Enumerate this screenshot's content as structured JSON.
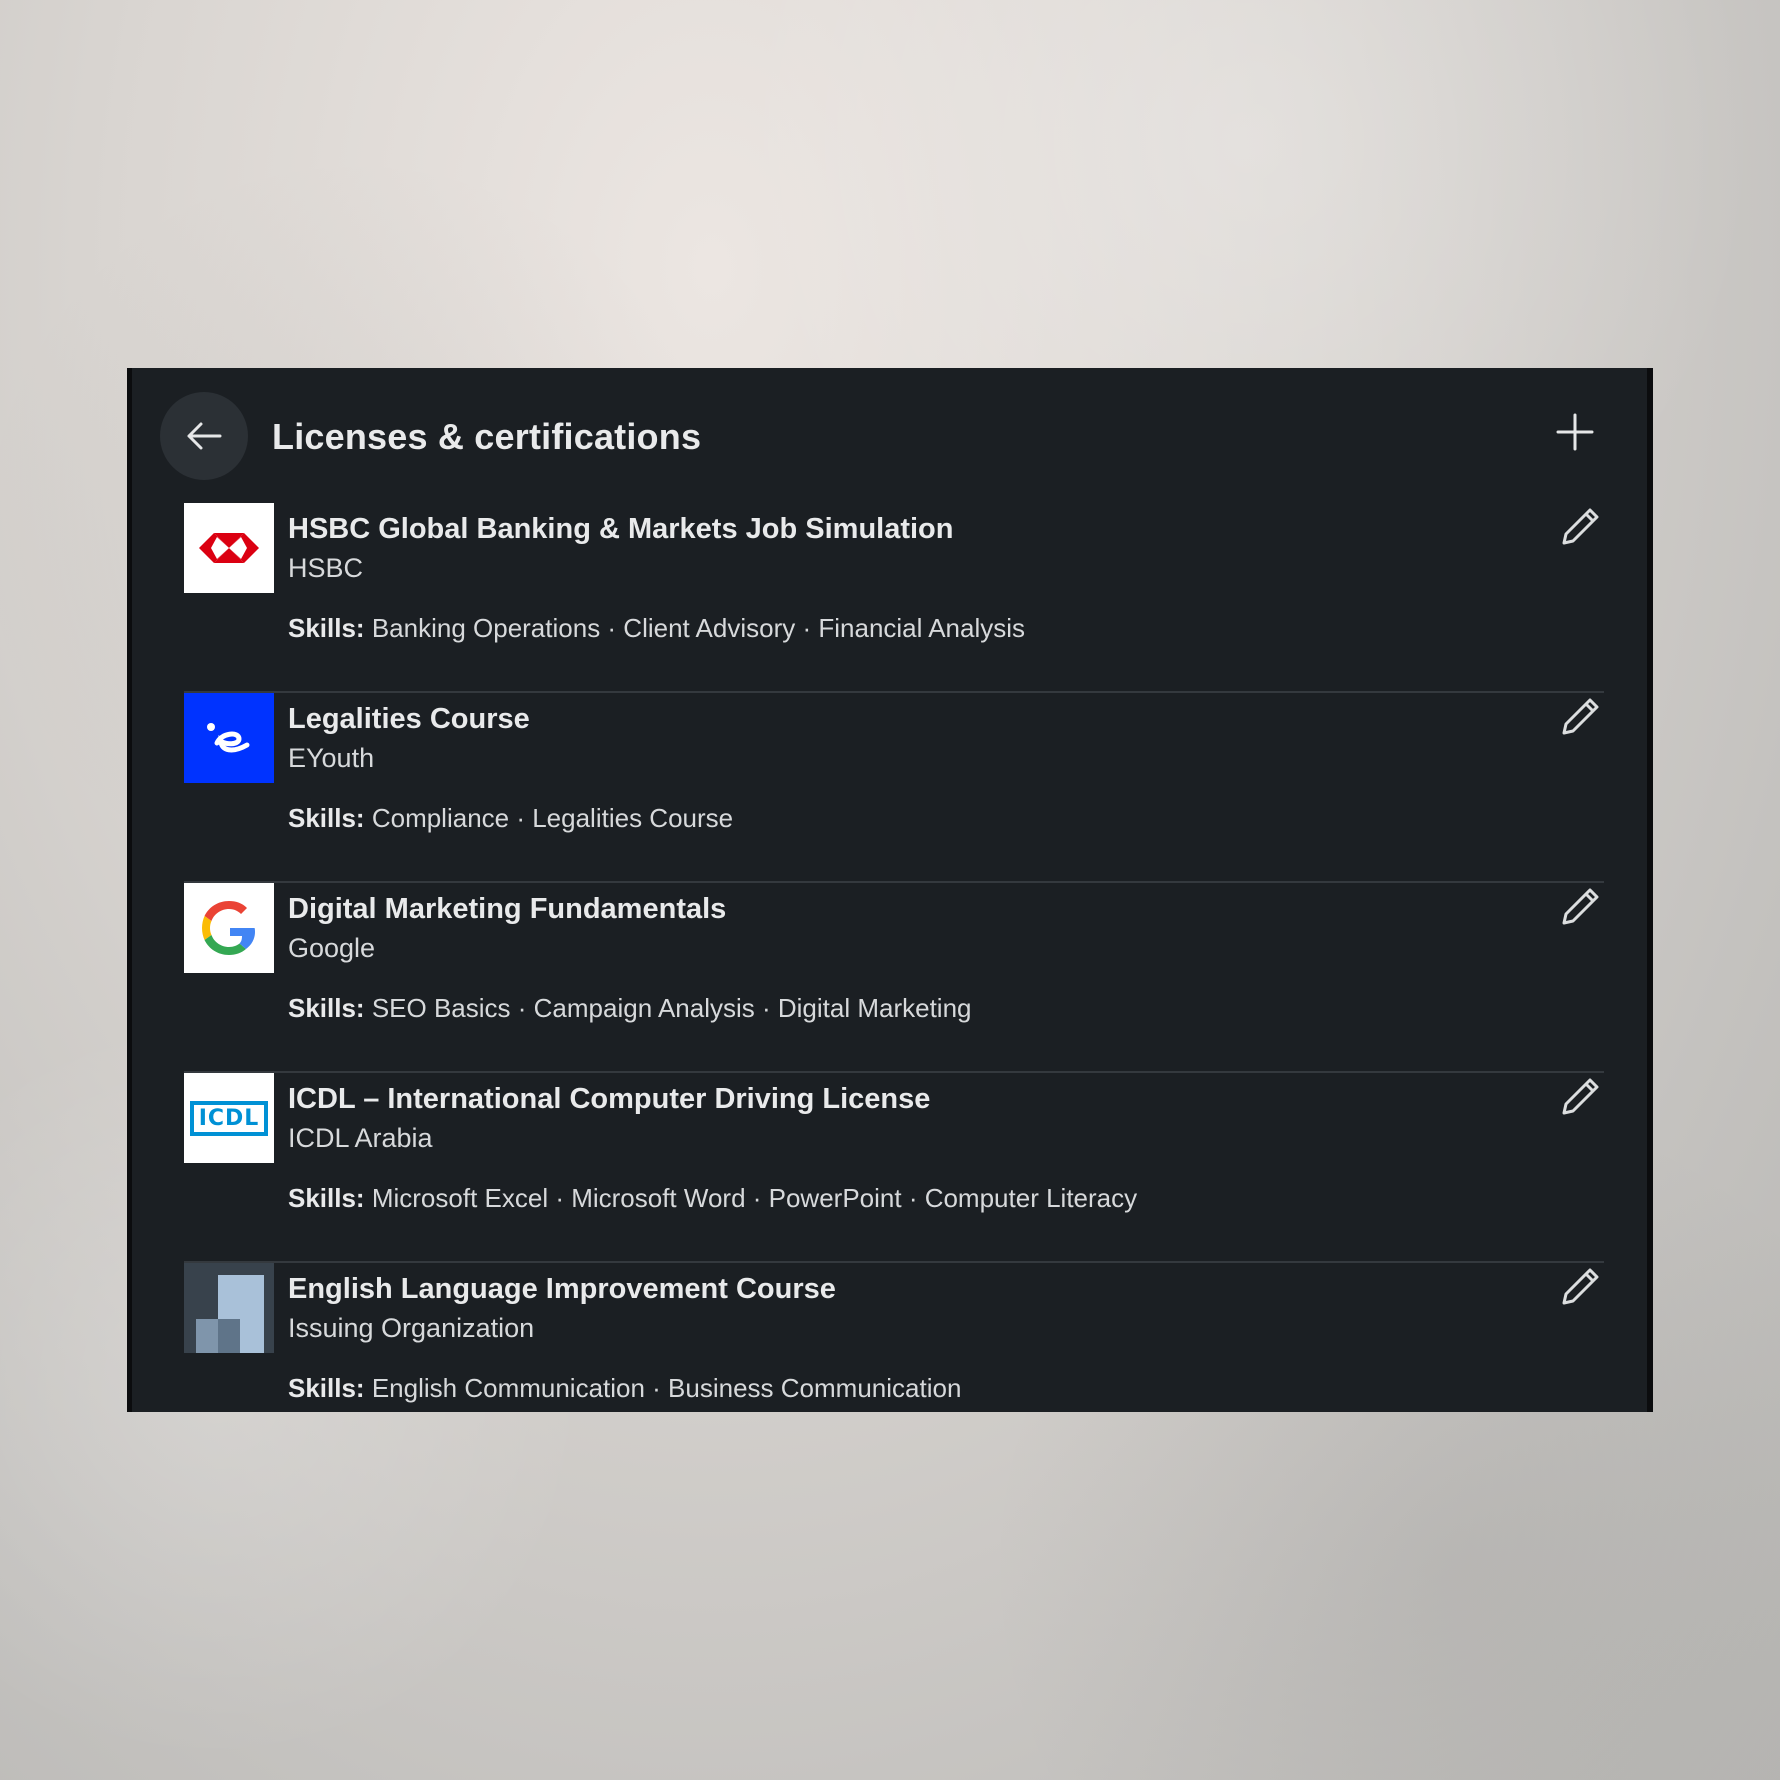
{
  "header": {
    "title": "Licenses & certifications"
  },
  "skills_label": "Skills:",
  "colors": {
    "panel_bg": "#1b1f23",
    "divider": "#34393e",
    "hsbc_red": "#db0011",
    "eyouth_blue": "#0033ff",
    "icdl_blue": "#0091d5"
  },
  "items": [
    {
      "title": "HSBC Global Banking & Markets Job Simulation",
      "issuer": "HSBC",
      "skills": "Banking Operations · Client Advisory · Financial Analysis",
      "logo": "hsbc-logo"
    },
    {
      "title": "Legalities Course",
      "issuer": "EYouth",
      "skills": "Compliance · Legalities Course",
      "logo": "eyouth-logo"
    },
    {
      "title": "Digital Marketing Fundamentals",
      "issuer": "Google",
      "skills": "SEO Basics · Campaign Analysis · Digital Marketing",
      "logo": "google-logo"
    },
    {
      "title": "ICDL – International Computer Driving License",
      "issuer": "ICDL Arabia",
      "skills": "Microsoft Excel · Microsoft Word · PowerPoint · Computer Literacy",
      "logo": "icdl-logo",
      "logo_text": "ICDL"
    },
    {
      "title": "English Language Improvement Course",
      "issuer": "Issuing Organization",
      "skills": "English Communication · Business Communication",
      "logo": "placeholder-organization-logo"
    }
  ]
}
